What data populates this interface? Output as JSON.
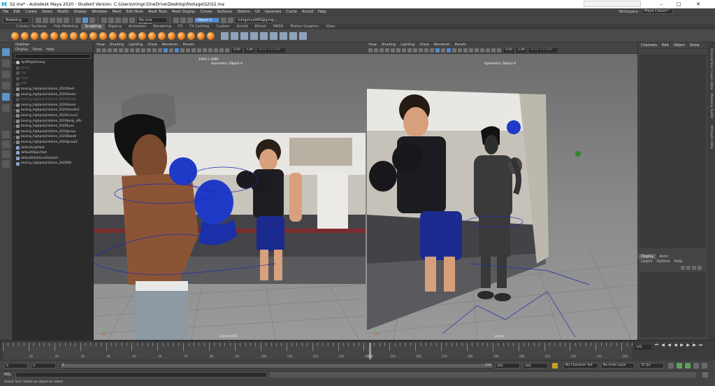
{
  "window": {
    "title": "S2.ma* - Autodesk Maya 2020 - Student Version: C:\\Users\\mingc\\OneDrive\\Desktop\\footage\\S2\\S2.ma",
    "app_icon": "M",
    "search_placeholder": "",
    "buttons": [
      "minimize",
      "maximize",
      "close"
    ]
  },
  "menubar": [
    "File",
    "Edit",
    "Create",
    "Select",
    "Modify",
    "Display",
    "Windows",
    "Mesh",
    "Edit Mesh",
    "Mesh Tools",
    "Mesh Display",
    "Curves",
    "Surfaces",
    "Deform",
    "UV",
    "Generate",
    "Cache",
    "Arnold",
    "Help"
  ],
  "workspace": {
    "label": "Workspace :",
    "value": "Maya Classic*"
  },
  "statusline": {
    "mode": "Modeling",
    "live_surface": "No Live Surface",
    "symmetry": "Object X",
    "user": "mingchuo999@gma..."
  },
  "shelf": {
    "tabs": [
      "Curves / Surfaces",
      "Poly Modeling",
      "Sculpting",
      "Rigging",
      "Animation",
      "Rendering",
      "FX",
      "FX Caching",
      "Custom",
      "Arnold",
      "Bifrost",
      "MASH",
      "Motion Graphics",
      "XGen"
    ],
    "active_tab": "Sculpting"
  },
  "outliner": {
    "title": "Outliner",
    "menu": [
      "Display",
      "Show",
      "Help"
    ],
    "items": [
      {
        "label": "SplitRightGroup",
        "type": "joint",
        "expand": "+"
      },
      {
        "label": "persp",
        "type": "dim",
        "expand": ""
      },
      {
        "label": "top",
        "type": "dim",
        "expand": ""
      },
      {
        "label": "front",
        "type": "dim",
        "expand": ""
      },
      {
        "label": "side",
        "type": "dim",
        "expand": ""
      },
      {
        "label": "boxing_highpolyhidame_2020Shell",
        "type": "mesh",
        "expand": ""
      },
      {
        "label": "boxing_highpolyhidame_2020Geom",
        "type": "mesh",
        "expand": "+"
      },
      {
        "label": "boxing_highpolyhidame_2020Geom",
        "type": "dim",
        "expand": ""
      },
      {
        "label": "boxing_highpolyhidame_2020Geom",
        "type": "mesh",
        "expand": "+"
      },
      {
        "label": "boxing_highpolyhidame_2020Handle1",
        "type": "mesh",
        "expand": "+"
      },
      {
        "label": "boxing_highpolyhidame_2020Curve1",
        "type": "mesh",
        "expand": "+"
      },
      {
        "label": "boxing_highpolyhidame_2020body_offs",
        "type": "mesh",
        "expand": "+"
      },
      {
        "label": "boxing_highpolyhidame_2020Eyes",
        "type": "mesh",
        "expand": "+"
      },
      {
        "label": "boxing_highpolyhidame_2020group",
        "type": "mesh",
        "expand": "+"
      },
      {
        "label": "boxing_highpolyhidame_2020Skelet",
        "type": "mesh",
        "expand": "+"
      },
      {
        "label": "boxing_highpolyhidame_2020group1",
        "type": "mesh",
        "expand": "+"
      },
      {
        "label": "defaultLightSet",
        "type": "set",
        "expand": ""
      },
      {
        "label": "defaultObjectSet",
        "type": "set",
        "expand": ""
      },
      {
        "label": "defaultHideFaceDataSet",
        "type": "set",
        "expand": ""
      },
      {
        "label": "boxing_highpolyhidame_2020RN",
        "type": "set",
        "expand": ""
      }
    ]
  },
  "viewports": [
    {
      "menu": [
        "View",
        "Shading",
        "Lighting",
        "Show",
        "Renderer",
        "Panels"
      ],
      "exposure": "0.00",
      "gamma": "1.00",
      "color_space": "ACES 1.0 SDR",
      "hud_top": "1920 x 1080",
      "hud_symmetry": "Symmetry: Object X",
      "camera": "Camera001"
    },
    {
      "menu": [
        "View",
        "Shading",
        "Lighting",
        "Show",
        "Renderer",
        "Panels"
      ],
      "exposure": "0.00",
      "gamma": "1.00",
      "color_space": "ACES 1.0 SDR",
      "hud_top": "",
      "hud_symmetry": "Symmetry: Object X",
      "camera": "persp"
    }
  ],
  "channelbox": {
    "menu": [
      "Channels",
      "Edit",
      "Object",
      "Show"
    ]
  },
  "layers": {
    "tabs": [
      "Display",
      "Anim"
    ],
    "active_tab": "Display",
    "menu": [
      "Layers",
      "Options",
      "Help"
    ]
  },
  "right_sidebar": [
    "Channel Box / Layer Editor",
    "Modeling Toolkit",
    "Attribute Editor"
  ],
  "timeslider": {
    "ticks": [
      "10",
      "20",
      "30",
      "40",
      "50",
      "60",
      "70",
      "80",
      "90",
      "100",
      "110",
      "120",
      "130",
      "140",
      "150",
      "160",
      "170",
      "180",
      "190",
      "200",
      "210",
      "220",
      "230",
      "240"
    ],
    "current_frame": "142",
    "frame_field": "142"
  },
  "range": {
    "start": "0",
    "range_start": "0",
    "range_start_small": "0",
    "range_end_small": "244",
    "range_end": "244",
    "end": "244",
    "character_set": "No Character Set",
    "anim_layer": "No Anim Layer",
    "fps": "25 fps"
  },
  "cmdline": {
    "label": "MEL"
  },
  "help_line": "Select Tool: Select an object to select"
}
